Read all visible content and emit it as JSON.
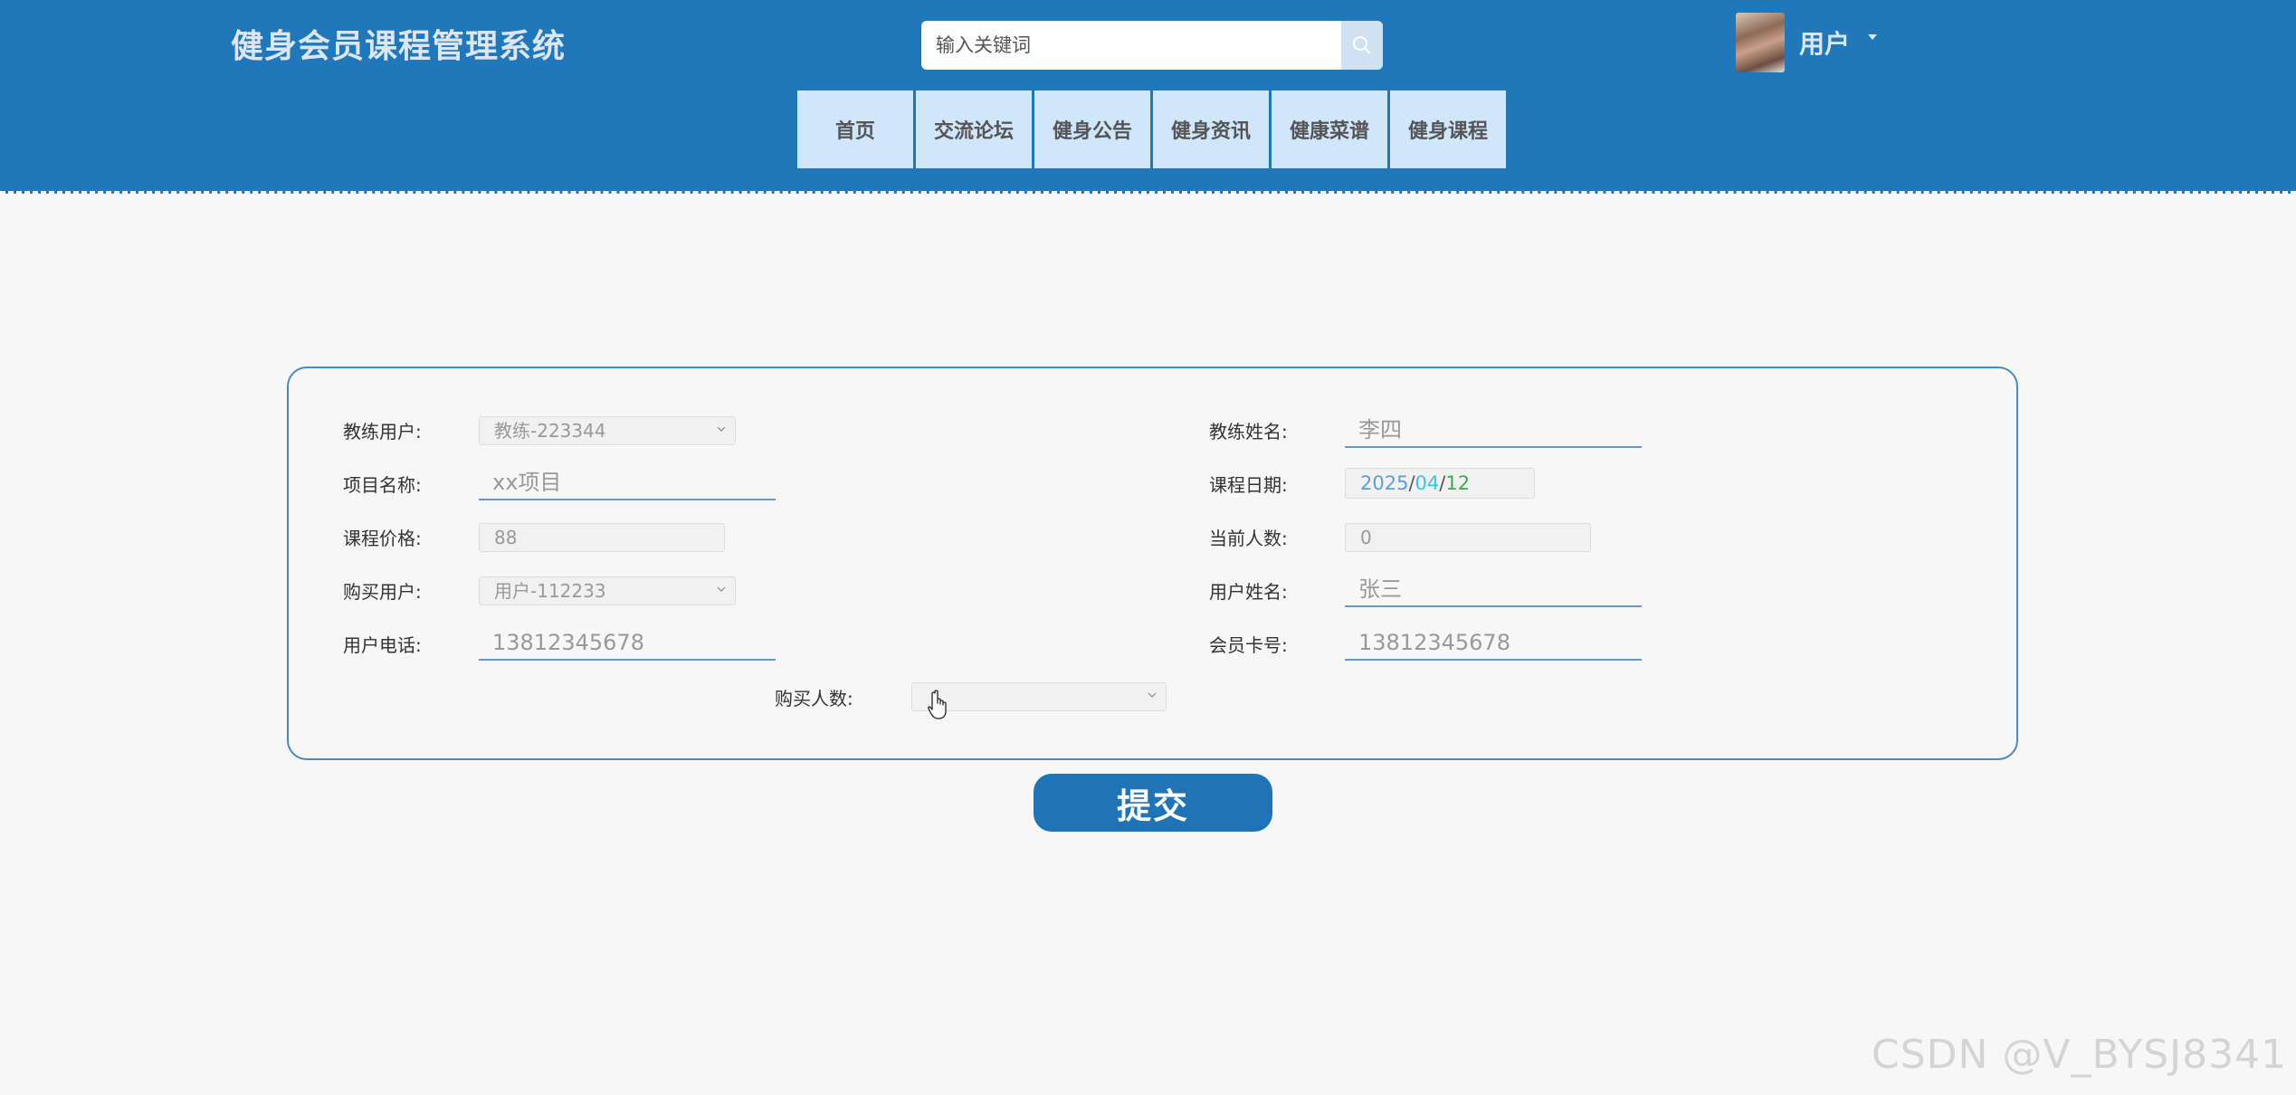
{
  "header": {
    "site_title": "健身会员课程管理系统",
    "search_placeholder": "输入关键词",
    "user_label": "用户",
    "nav": [
      "首页",
      "交流论坛",
      "健身公告",
      "健身资讯",
      "健康菜谱",
      "健身课程"
    ]
  },
  "form": {
    "coach_user": {
      "label": "教练用户:",
      "value": "教练-223344"
    },
    "coach_name": {
      "label": "教练姓名:",
      "value": "李四"
    },
    "project_name": {
      "label": "项目名称:",
      "value": "xx项目"
    },
    "course_date": {
      "label": "课程日期:",
      "year": "2025",
      "month": "04",
      "day": "12",
      "sep": "/"
    },
    "course_price": {
      "label": "课程价格:",
      "value": "88"
    },
    "current_count": {
      "label": "当前人数:",
      "value": "0"
    },
    "buyer_user": {
      "label": "购买用户:",
      "value": "用户-112233"
    },
    "user_name": {
      "label": "用户姓名:",
      "value": "张三"
    },
    "user_phone": {
      "label": "用户电话:",
      "value": "13812345678"
    },
    "member_card": {
      "label": "会员卡号:",
      "value": "13812345678"
    },
    "buy_count": {
      "label": "购买人数:",
      "value": ""
    }
  },
  "submit_label": "提交",
  "watermark": "CSDN @V_BYSJ8341",
  "colors": {
    "header_bg": "#2078ba",
    "nav_bg": "#d0e6fb",
    "submit_bg": "#1f73b7",
    "date_year": "#5aa0d8",
    "date_month": "#3fc4d8",
    "date_day": "#3daa4c"
  },
  "icons": [
    "search-icon",
    "caret-down-icon",
    "chevron-down-icon",
    "hand-pointer-icon"
  ]
}
